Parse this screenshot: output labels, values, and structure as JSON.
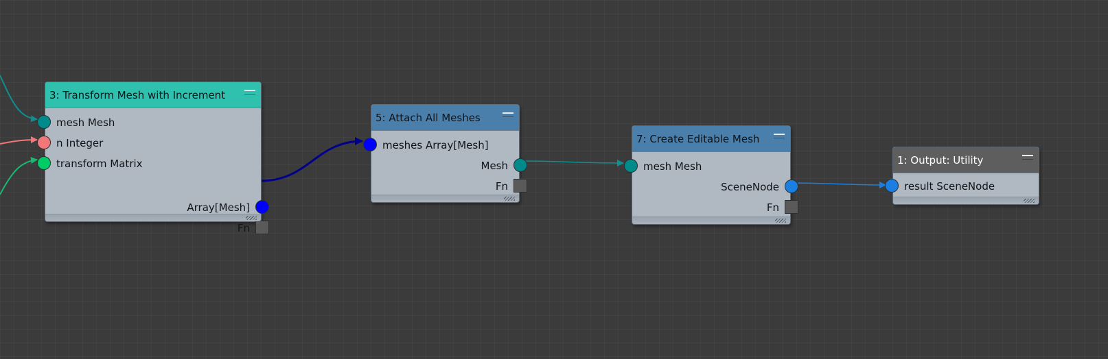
{
  "nodes": {
    "n3": {
      "title": "3: Transform Mesh with Increment",
      "header_color": "#2fc0ae",
      "inputs": [
        "mesh Mesh",
        "n Integer",
        "transform Matrix"
      ],
      "input_colors": [
        "#008b8b",
        "#f07878",
        "#00cc66"
      ],
      "outputs": [
        "Array[Mesh]",
        "Fn"
      ],
      "output_colors": [
        "#0000ff"
      ]
    },
    "n5": {
      "title": "5: Attach All Meshes",
      "header_color": "#4a7fab",
      "inputs": [
        "meshes Array[Mesh]"
      ],
      "input_colors": [
        "#0000ff"
      ],
      "outputs": [
        "Mesh",
        "Fn"
      ],
      "output_colors": [
        "#008b8b"
      ]
    },
    "n7": {
      "title": "7: Create Editable Mesh",
      "header_color": "#4a7fab",
      "inputs": [
        "mesh Mesh"
      ],
      "input_colors": [
        "#008b8b"
      ],
      "outputs": [
        "SceneNode",
        "Fn"
      ],
      "output_colors": [
        "#1a7fe0"
      ]
    },
    "n1": {
      "title": "1: Output: Utility",
      "header_color": "#5e5e5e",
      "inputs": [
        "result SceneNode"
      ],
      "input_colors": [
        "#1a7fe0"
      ]
    }
  },
  "wire_colors": {
    "mesh_in": "#0f8f8f",
    "integer_in": "#f07878",
    "matrix_in": "#1ab870",
    "array_mesh": "#00008b",
    "mesh": "#0f8f8f",
    "scenenode": "#1a7fe0"
  }
}
